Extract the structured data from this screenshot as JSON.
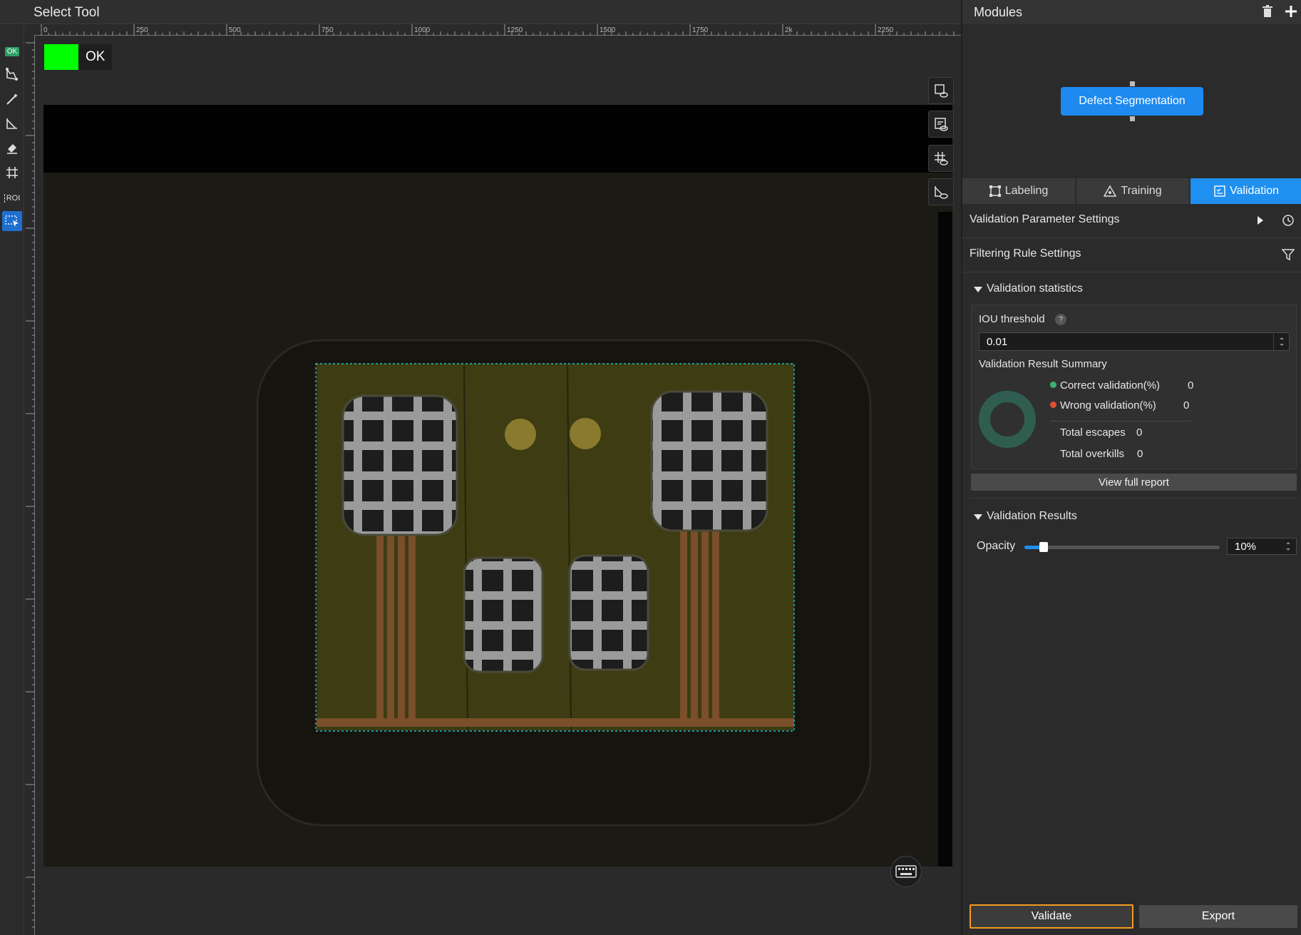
{
  "canvas": {
    "tool_title": "Select Tool",
    "status_label": "OK",
    "status_color": "#00ff00",
    "ruler_labels": [
      "0",
      "250",
      "500",
      "750",
      "1000",
      "1250",
      "1500",
      "1750",
      "2k",
      "2250"
    ]
  },
  "toolbar": {
    "ok_tag": "OK",
    "roi_tag": "ROI",
    "icons": [
      "polygon-icon",
      "magic-wand-icon",
      "polyline-icon",
      "eraser-icon",
      "grid-icon",
      "roi-icon",
      "select-box-icon"
    ]
  },
  "view_tools": [
    "show-labels-icon",
    "show-results-icon",
    "show-grid-icon",
    "show-mask-icon",
    "keyboard-icon"
  ],
  "panel": {
    "title": "Modules",
    "module_node": "Defect Segmentation",
    "tabs": [
      {
        "label": "Labeling",
        "active": false
      },
      {
        "label": "Training",
        "active": false
      },
      {
        "label": "Validation",
        "active": true
      }
    ],
    "validation_param_settings": "Validation Parameter Settings",
    "filtering_rule_settings": "Filtering Rule Settings",
    "stats_section": "Validation statistics",
    "iou_label": "IOU threshold",
    "iou_help": "?",
    "iou_value": "0.01",
    "summary_label": "Validation Result Summary",
    "correct_label": "Correct validation(%)",
    "correct_value": "0",
    "correct_color": "#3cb371",
    "wrong_label": "Wrong validation(%)",
    "wrong_value": "0",
    "wrong_color": "#e05030",
    "escapes_label": "Total escapes",
    "escapes_value": "0",
    "overkills_label": "Total overkills",
    "overkills_value": "0",
    "view_report": "View full report",
    "results_section": "Validation Results",
    "opacity_label": "Opacity",
    "opacity_value": "10%",
    "opacity_fraction": 0.1,
    "validate_button": "Validate",
    "export_button": "Export",
    "accent_color": "#1f8ff0",
    "validate_border_color": "#f39b1f"
  }
}
